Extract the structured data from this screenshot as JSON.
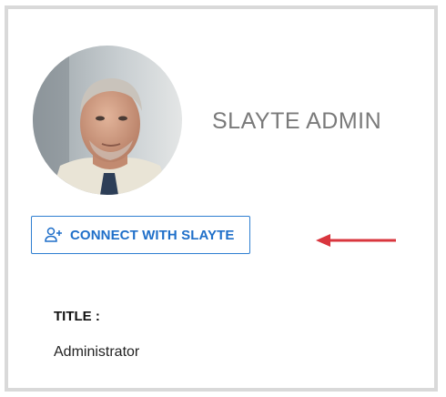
{
  "profile": {
    "name": "SLAYTE ADMIN",
    "title_label": "TITLE :",
    "title_value": "Administrator"
  },
  "connect_button": {
    "label": "CONNECT WITH SLAYTE",
    "icon": "add-user-icon"
  },
  "annotation": {
    "icon": "arrow-left-icon",
    "color": "#d9363e"
  },
  "colors": {
    "accent": "#1f6fc9",
    "border": "#d9d9d9",
    "name_text": "#7a7a7a"
  }
}
